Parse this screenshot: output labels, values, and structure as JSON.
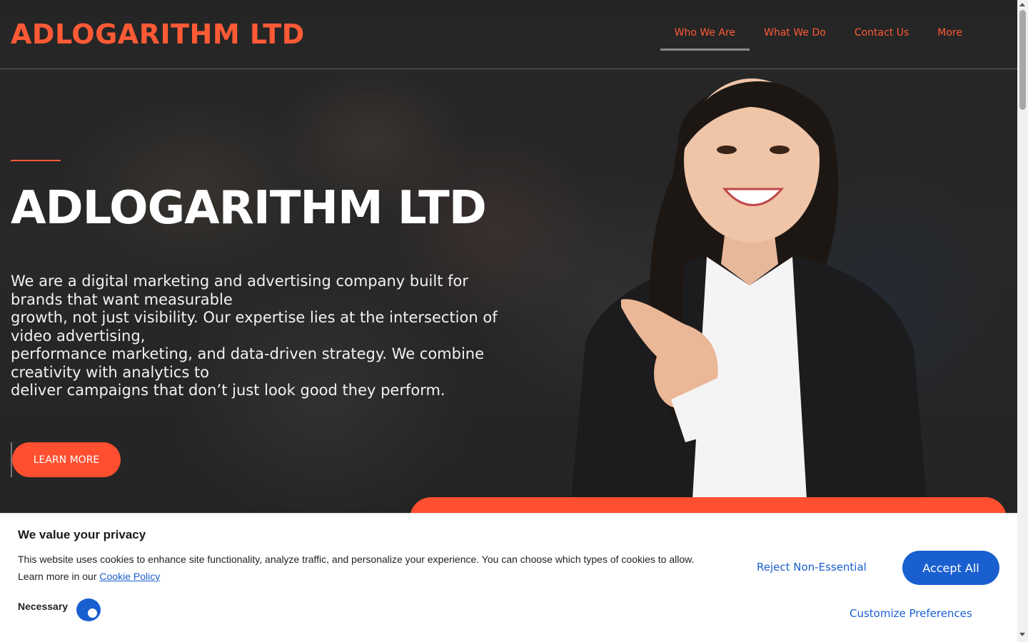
{
  "header": {
    "logo": "ADLOGARITHM LTD",
    "nav": [
      {
        "label": "Who We Are",
        "active": true
      },
      {
        "label": "What We Do"
      },
      {
        "label": "Contact Us"
      },
      {
        "label": "More"
      }
    ]
  },
  "hero": {
    "title": "ADLOGARITHM LTD",
    "description_lines": [
      "We are a digital marketing and advertising company built for brands that want measurable",
      "growth, not just visibility. Our expertise lies at the intersection of video advertising,",
      "performance marketing, and data-driven strategy. We combine creativity with analytics to",
      "deliver campaigns that don’t just look good they perform."
    ],
    "cta_label": "LEARN MORE"
  },
  "cookie_banner": {
    "title": "We value your privacy",
    "text": "This website uses cookies to enhance site functionality, analyze traffic, and personalize your experience. You can choose which types of cookies to allow.",
    "learn_more_prefix": "Learn more in our ",
    "policy_link": "Cookie Policy",
    "necessary_label": "Necessary",
    "reject_label": "Reject Non-Essential",
    "accept_label": "Accept All",
    "customize_label": "Customize Preferences"
  },
  "colors": {
    "accent": "#ff5a36",
    "primary_blue": "#1a5fd0"
  }
}
